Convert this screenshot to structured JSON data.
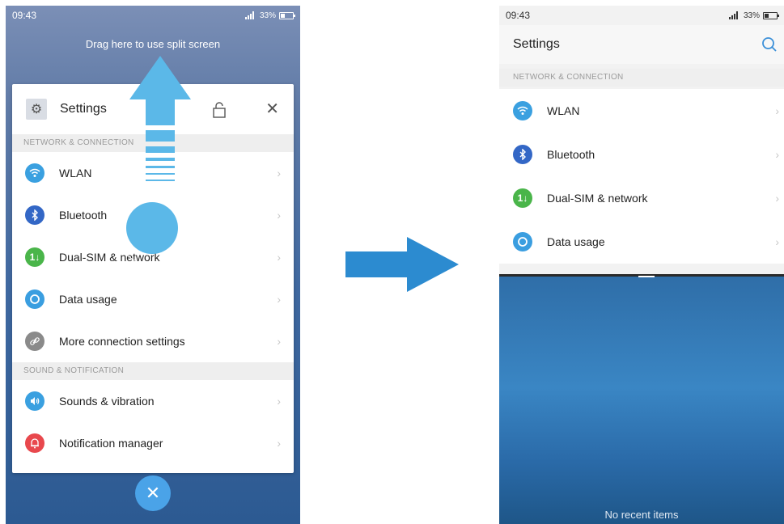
{
  "left_phone": {
    "status": {
      "time": "09:43",
      "battery": "33%"
    },
    "drag_hint": "Drag here to use split screen",
    "card": {
      "title": "Settings",
      "sections": [
        {
          "header": "NETWORK & CONNECTION",
          "items": [
            {
              "label": "WLAN",
              "icon": "wifi-icon",
              "color": "#3aa0e0"
            },
            {
              "label": "Bluetooth",
              "icon": "bluetooth-icon",
              "color": "#3367c6"
            },
            {
              "label": "Dual-SIM & network",
              "icon": "sim-icon",
              "color": "#4ab54a"
            },
            {
              "label": "Data usage",
              "icon": "data-usage-icon",
              "color": "#3a9ee0"
            },
            {
              "label": "More connection settings",
              "icon": "link-icon",
              "color": "#8a8a8a"
            }
          ]
        },
        {
          "header": "SOUND & NOTIFICATION",
          "items": [
            {
              "label": "Sounds & vibration",
              "icon": "speaker-icon",
              "color": "#3aa0e0"
            },
            {
              "label": "Notification manager",
              "icon": "bell-icon",
              "color": "#e8484d"
            }
          ]
        }
      ]
    }
  },
  "right_phone": {
    "status": {
      "time": "09:43",
      "battery": "33%"
    },
    "title": "Settings",
    "section_header": "NETWORK & CONNECTION",
    "items": [
      {
        "label": "WLAN",
        "icon": "wifi-icon",
        "color": "#3aa0e0"
      },
      {
        "label": "Bluetooth",
        "icon": "bluetooth-icon",
        "color": "#3367c6"
      },
      {
        "label": "Dual-SIM & network",
        "icon": "sim-icon",
        "color": "#4ab54a"
      },
      {
        "label": "Data usage",
        "icon": "data-usage-icon",
        "color": "#3a9ee0"
      }
    ],
    "recent_empty": "No recent items"
  },
  "colors": {
    "arrow": "#2c8bd0",
    "drag_arrow": "#5bb8e8",
    "fab": "#4aa3e8"
  }
}
